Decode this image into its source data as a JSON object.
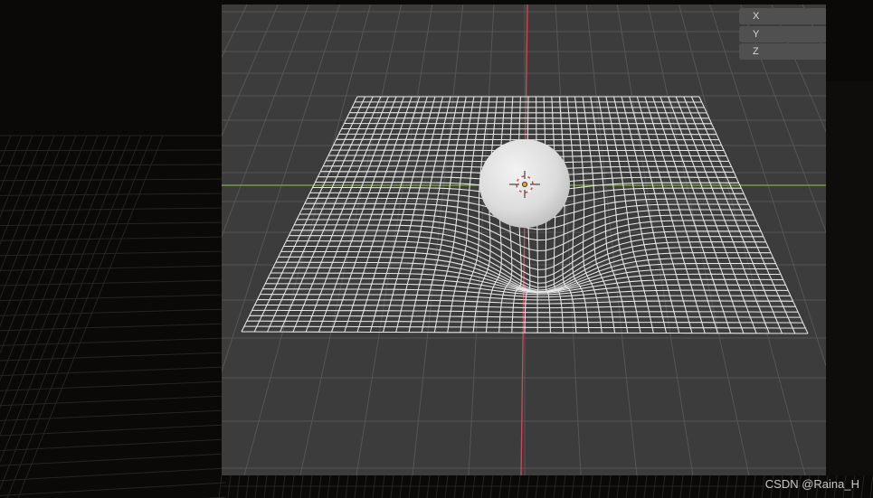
{
  "viewport": {
    "axis_buttons": [
      "X",
      "Y",
      "Z"
    ]
  },
  "watermark": "CSDN @Raina_H",
  "colors": {
    "viewport_bg": "#3c3c3c",
    "grid_line": "#555555",
    "x_axis": "#7fb13a",
    "z_axis": "#d04a56",
    "mesh": "#e8e8e8",
    "sphere": "#dcdcdc"
  },
  "scene": {
    "objects": [
      "sphere",
      "deformed-plane-mesh",
      "3d-cursor"
    ]
  }
}
